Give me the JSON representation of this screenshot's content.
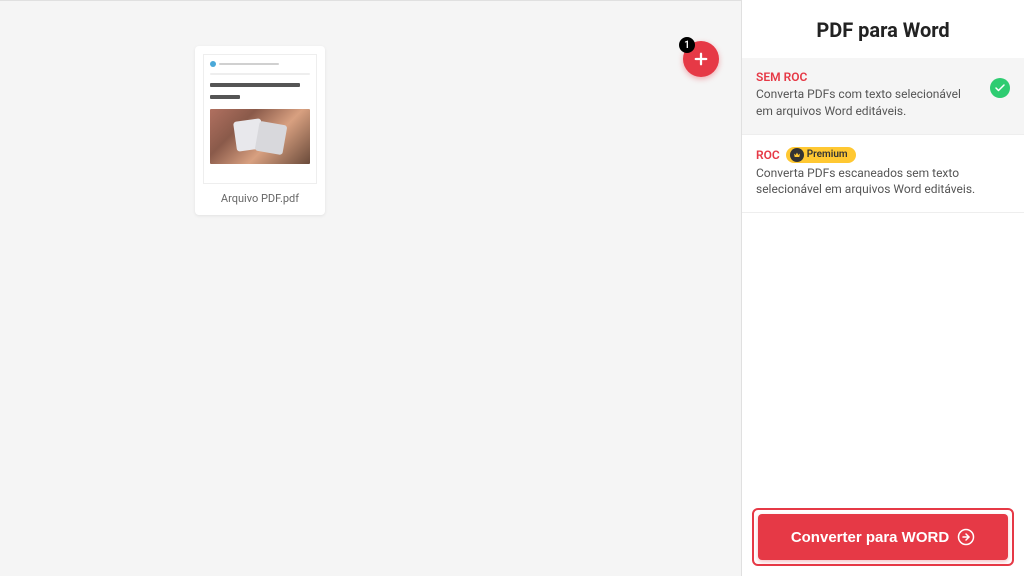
{
  "main": {
    "files": [
      {
        "name": "Arquivo PDF.pdf"
      }
    ],
    "add_button": {
      "count": "1",
      "icon": "plus-icon"
    }
  },
  "sidebar": {
    "title": "PDF para Word",
    "options": [
      {
        "title": "SEM ROC",
        "description": "Converta PDFs com texto selecionável em arquivos Word editáveis.",
        "selected": true
      },
      {
        "title": "ROC",
        "premium_label": "Premium",
        "description": "Converta PDFs escaneados sem texto selecionável em arquivos Word editáveis.",
        "selected": false
      }
    ],
    "convert_label": "Converter para WORD"
  }
}
